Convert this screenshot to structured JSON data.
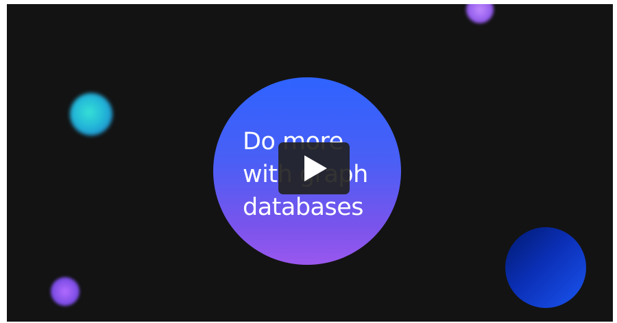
{
  "video": {
    "headline_line1": "Do more",
    "headline_line2": "with graph",
    "headline_line3": "databases",
    "play_icon": "play-icon"
  },
  "colors": {
    "background": "#131313",
    "hero_circle_top": "#2f63ff",
    "hero_circle_bottom": "#9a58ee",
    "play_button": "#222222"
  }
}
